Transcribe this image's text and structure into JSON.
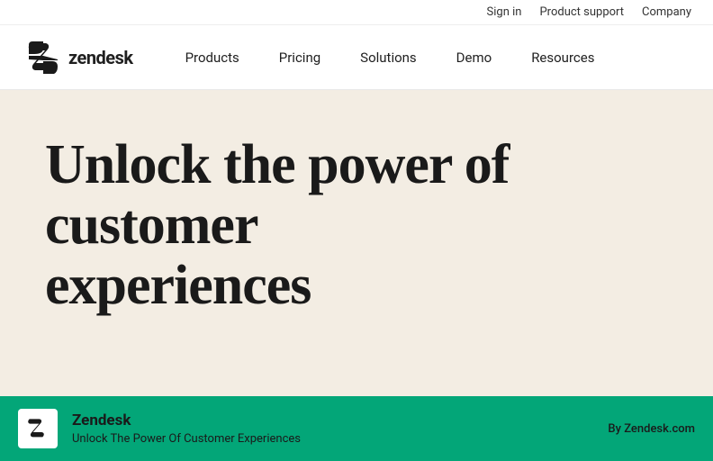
{
  "utility_bar": {
    "sign_in": "Sign in",
    "product_support": "Product support",
    "company": "Company"
  },
  "nav": {
    "logo_text": "zendesk",
    "links": [
      {
        "label": "Products",
        "id": "products"
      },
      {
        "label": "Pricing",
        "id": "pricing"
      },
      {
        "label": "Solutions",
        "id": "solutions"
      },
      {
        "label": "Demo",
        "id": "demo"
      },
      {
        "label": "Resources",
        "id": "resources"
      }
    ]
  },
  "hero": {
    "title": "Unlock the power of customer experiences"
  },
  "bottom_bar": {
    "site_name": "Zendesk",
    "tagline": "Unlock The Power Of Customer Experiences",
    "domain": "By Zendesk.com"
  },
  "colors": {
    "hero_bg": "#f3ede3",
    "bottom_bg": "#03a678",
    "logo_dark": "#1a1a1a"
  }
}
